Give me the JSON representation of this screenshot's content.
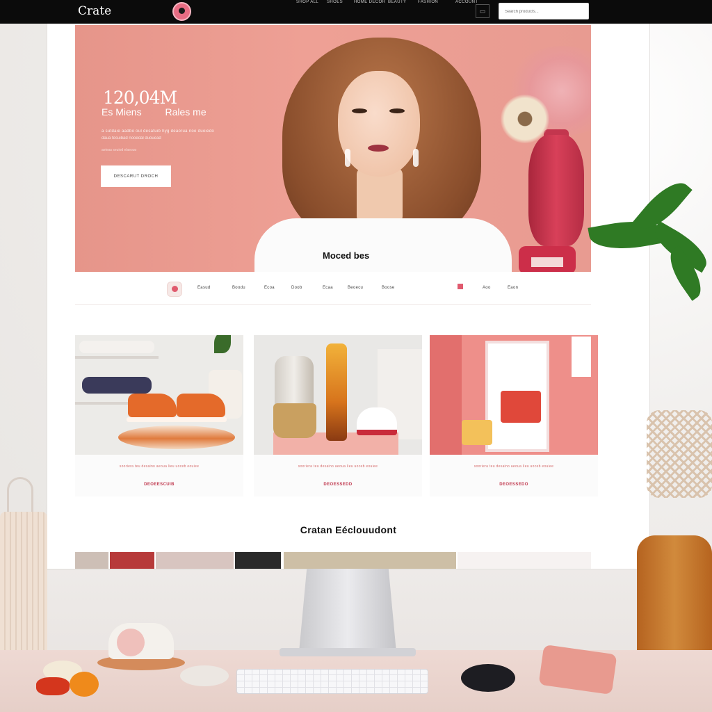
{
  "topbar": {
    "brand": "Crate",
    "nav": [
      {
        "label": "SHOP ALL"
      },
      {
        "label": "SHOES"
      },
      {
        "label": "HOME DECOR"
      },
      {
        "label": "BEAUTY"
      },
      {
        "label": "FASHION"
      },
      {
        "label": "ACCOUNT"
      }
    ],
    "search_placeholder": "Search products..."
  },
  "hero": {
    "headline_number": "120,04M",
    "headline_left": "Es Miens",
    "headline_right": "Rales me",
    "subline_1": "a sutdaie aadbo oul desatuib hyg deaorua noe duoiedo",
    "subline_2": "daua tesuibad nooedal duouead",
    "subline_3": "aeteas seuiod elaeouo",
    "cta_label": "DESCARUT DROCH",
    "caption": "Moced bes"
  },
  "category_bar": {
    "items": [
      {
        "label": "Easud"
      },
      {
        "label": "Boodu"
      },
      {
        "label": "Ecoa"
      },
      {
        "label": "Doob"
      },
      {
        "label": "Ecaa"
      },
      {
        "label": "Beoecu"
      },
      {
        "label": "Boose"
      },
      {
        "label": "Aoo"
      },
      {
        "label": "Eaon"
      }
    ]
  },
  "cards": [
    {
      "desc": "sooriera teu desaino aeoua lieu uoceb eouiee",
      "link": "DEOEESCUIB"
    },
    {
      "desc": "sooriera teu desaino aeoua lieu uoceb eouiee",
      "link": "DEOESSEDD"
    },
    {
      "desc": "sooriera teu desaino aeoua lieu uoceb eouiee",
      "link": "DEOESSEDO"
    }
  ],
  "section": {
    "heading": "Cratan Eéclouudont"
  },
  "colors": {
    "topbar": "#0b0b0b",
    "hero": "#eea095",
    "accent": "#c0394f",
    "vase": "#d84059"
  },
  "icons": [
    "logo-mark-icon",
    "window-icon",
    "heart-icon",
    "flag-icon"
  ]
}
